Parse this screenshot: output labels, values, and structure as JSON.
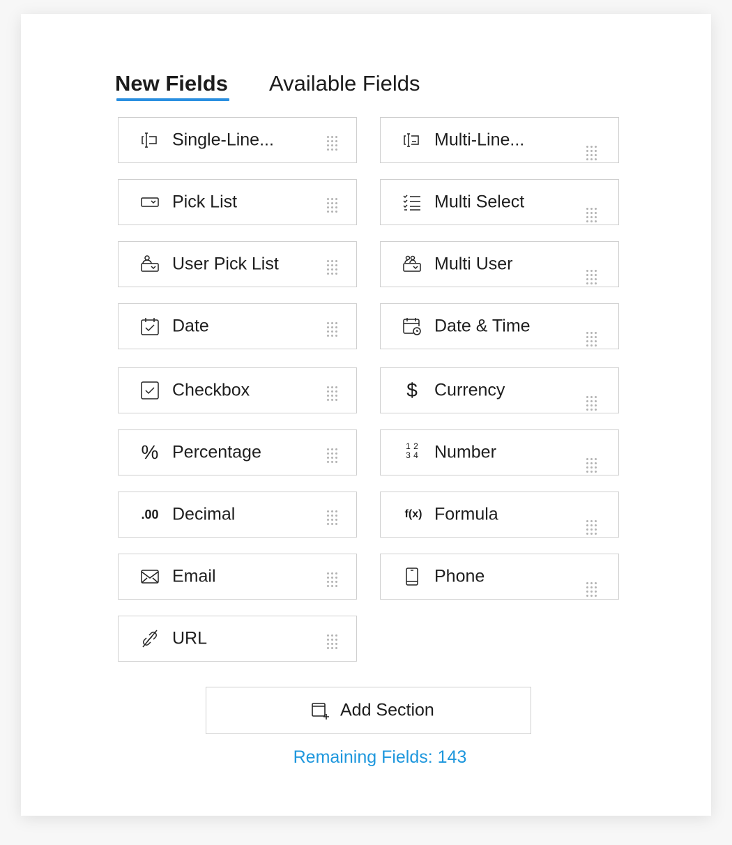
{
  "tabs": [
    {
      "label": "New Fields",
      "active": true
    },
    {
      "label": "Available Fields",
      "active": false
    }
  ],
  "fields": [
    {
      "label": "Single-Line...",
      "icon": "single-line-icon",
      "col": "left"
    },
    {
      "label": "Multi-Line...",
      "icon": "multi-line-icon",
      "col": "right"
    },
    {
      "label": "Pick List",
      "icon": "pick-list-icon",
      "col": "left"
    },
    {
      "label": "Multi Select",
      "icon": "multi-select-icon",
      "col": "right"
    },
    {
      "label": "User Pick List",
      "icon": "user-pick-list-icon",
      "col": "left"
    },
    {
      "label": "Multi User",
      "icon": "multi-user-icon",
      "col": "right"
    },
    {
      "label": "Date",
      "icon": "date-icon",
      "col": "left"
    },
    {
      "label": "Date & Time",
      "icon": "date-time-icon",
      "col": "right"
    },
    {
      "label": "Checkbox",
      "icon": "checkbox-icon",
      "col": "left"
    },
    {
      "label": "Currency",
      "icon": "currency-icon",
      "col": "right"
    },
    {
      "label": "Percentage",
      "icon": "percentage-icon",
      "col": "left"
    },
    {
      "label": "Number",
      "icon": "number-icon",
      "col": "right"
    },
    {
      "label": "Decimal",
      "icon": "decimal-icon",
      "col": "left"
    },
    {
      "label": "Formula",
      "icon": "formula-icon",
      "col": "right"
    },
    {
      "label": "Email",
      "icon": "email-icon",
      "col": "left"
    },
    {
      "label": "Phone",
      "icon": "phone-icon",
      "col": "right"
    },
    {
      "label": "URL",
      "icon": "url-icon",
      "col": "left"
    }
  ],
  "icon_text": {
    "currency": "$",
    "percentage": "%",
    "decimal": ".00",
    "formula": "f(x)",
    "number_digits": [
      "1",
      "2",
      "3",
      "4"
    ]
  },
  "add_section": {
    "label": "Add Section",
    "icon": "add-section-icon"
  },
  "remaining": {
    "label": "Remaining Fields: 143"
  },
  "colors": {
    "accent": "#2a8fe0",
    "remaining_text": "#1e97dd",
    "border": "#cfcfcf"
  }
}
